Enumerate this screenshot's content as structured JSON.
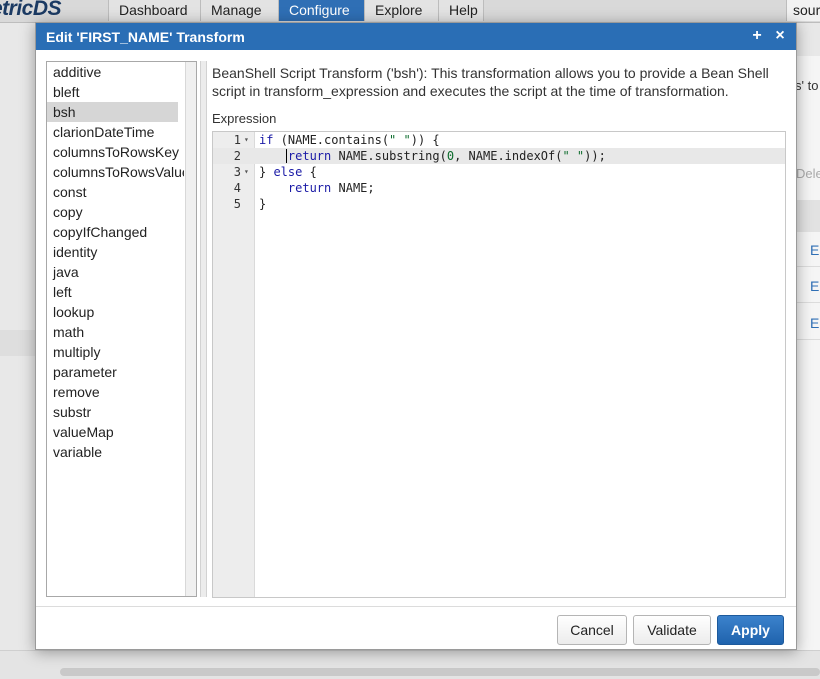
{
  "app": {
    "logo_text": "etricDS",
    "menu": [
      "Dashboard",
      "Manage",
      "Configure",
      "Explore",
      "Help"
    ],
    "active_menu": "Configure",
    "user_chip": "sour",
    "bg_fragments": {
      "tail": "s' to",
      "delete": "Delet",
      "row_link": "E"
    }
  },
  "dialog": {
    "title": "Edit 'FIRST_NAME' Transform",
    "maximize_symbol": "+",
    "close_symbol": "×",
    "transform_types": [
      "additive",
      "bleft",
      "bsh",
      "clarionDateTime",
      "columnsToRowsKey",
      "columnsToRowsValue",
      "const",
      "copy",
      "copyIfChanged",
      "identity",
      "java",
      "left",
      "lookup",
      "math",
      "multiply",
      "parameter",
      "remove",
      "substr",
      "valueMap",
      "variable"
    ],
    "selected_type": "bsh",
    "description": "BeanShell Script Transform ('bsh'): This transformation allows you to provide a Bean Shell script in transform_expression and executes the script at the time of transformation.",
    "expression_label": "Expression",
    "code_lines": [
      "if (NAME.contains(\" \")) {",
      "    return NAME.substring(0, NAME.indexOf(\" \"));",
      "} else {",
      "    return NAME;",
      "}"
    ],
    "line_numbers": [
      "1",
      "2",
      "3",
      "4",
      "5"
    ],
    "fold_lines": [
      1,
      3
    ],
    "active_line": 2,
    "buttons": {
      "cancel": "Cancel",
      "validate": "Validate",
      "apply": "Apply"
    }
  },
  "colors": {
    "header_blue": "#2a6eb5",
    "apply_blue": "#2a6eb5",
    "keyword_blue": "#1a1aa6",
    "string_green": "#0b6b2b"
  }
}
